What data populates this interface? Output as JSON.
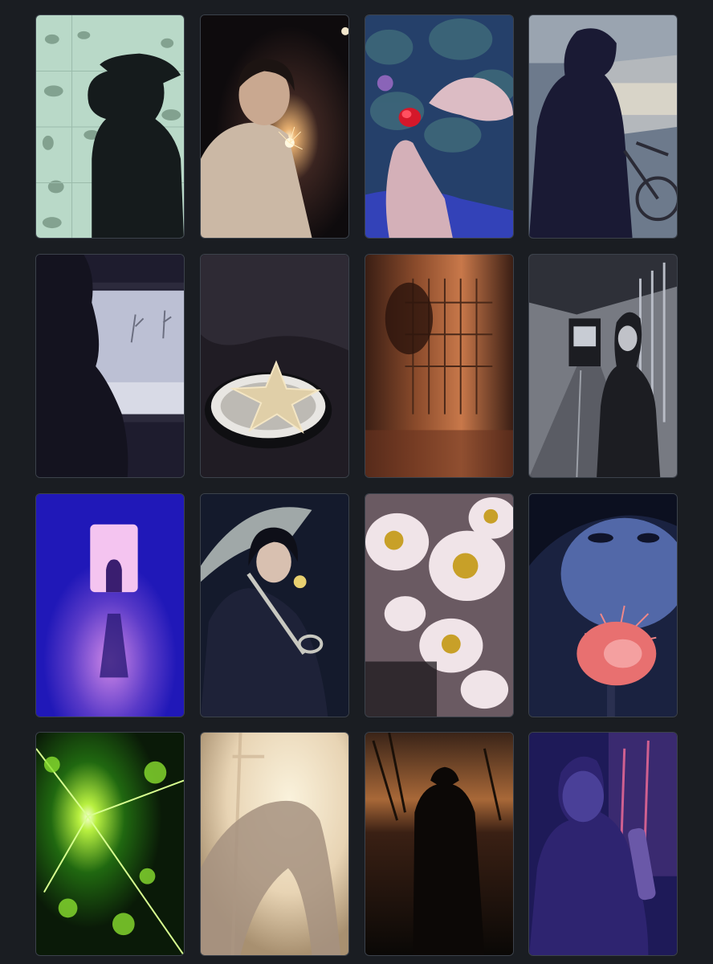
{
  "gallery": {
    "tiles": [
      {
        "id": "still-01",
        "subject": "silhouette-in-hat-icon"
      },
      {
        "id": "still-02",
        "subject": "sparkler-portrait-icon"
      },
      {
        "id": "still-03",
        "subject": "hands-red-flower-icon"
      },
      {
        "id": "still-04",
        "subject": "figure-with-bicycle-icon"
      },
      {
        "id": "still-05",
        "subject": "window-silhouette-icon"
      },
      {
        "id": "still-06",
        "subject": "starfish-icon"
      },
      {
        "id": "still-07",
        "subject": "amber-corridor-icon"
      },
      {
        "id": "still-08",
        "subject": "figure-in-corridor-icon"
      },
      {
        "id": "still-09",
        "subject": "doorway-silhouette-icon"
      },
      {
        "id": "still-10",
        "subject": "umbrella-portrait-icon"
      },
      {
        "id": "still-11",
        "subject": "daisies-icon"
      },
      {
        "id": "still-12",
        "subject": "face-with-red-flower-icon"
      },
      {
        "id": "still-13",
        "subject": "green-starburst-icon"
      },
      {
        "id": "still-14",
        "subject": "hazy-figure-icon"
      },
      {
        "id": "still-15",
        "subject": "figure-in-hat-sunset-icon"
      },
      {
        "id": "still-16",
        "subject": "child-violet-light-icon"
      }
    ]
  }
}
